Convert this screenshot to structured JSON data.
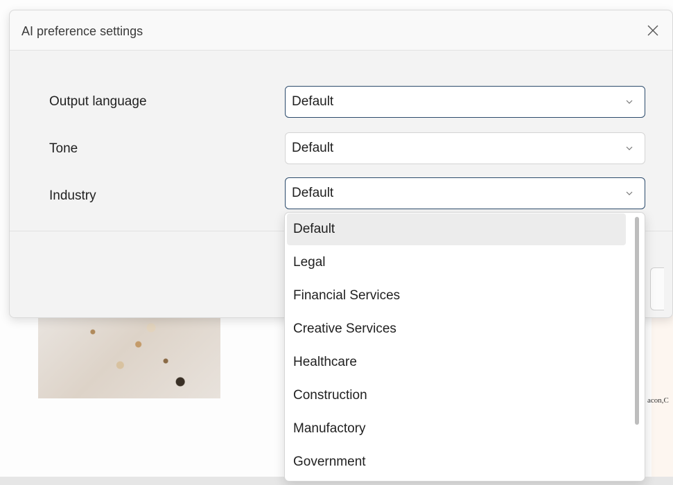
{
  "background": {
    "snippet": "acon,C"
  },
  "dialog": {
    "title": "AI preference settings",
    "close_icon": "close-icon",
    "rows": [
      {
        "label": "Output language",
        "value": "Default"
      },
      {
        "label": "Tone",
        "value": "Default"
      },
      {
        "label": "Industry",
        "value": "Default"
      }
    ]
  },
  "dropdown": {
    "selected": "Default",
    "options": [
      "Default",
      "Legal",
      "Financial Services",
      "Creative Services",
      "Healthcare",
      "Construction",
      "Manufactory",
      "Government"
    ]
  },
  "colors": {
    "active_border": "#2b4a6b",
    "selected_option_bg": "#ececec"
  }
}
